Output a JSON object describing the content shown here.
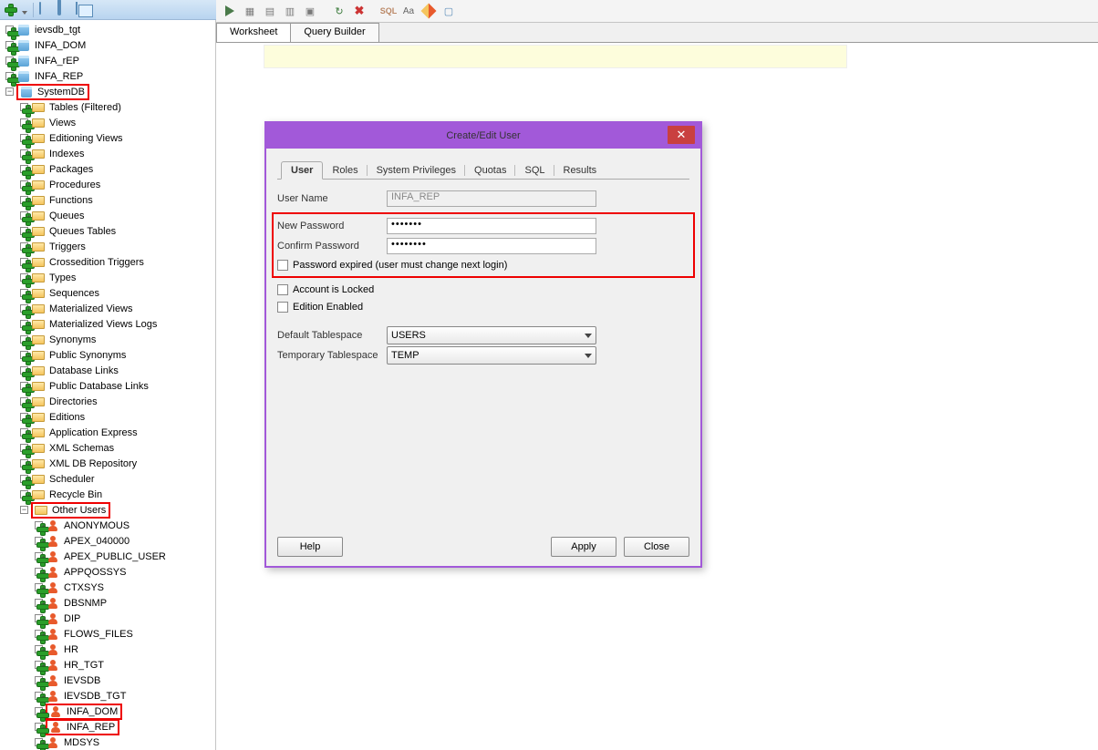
{
  "toolbar_left": {
    "items": [
      "add",
      "dropdown",
      "sep",
      "db",
      "filter",
      "copy"
    ]
  },
  "tree": {
    "connections": [
      "ievsdb_tgt",
      "INFA_DOM",
      "INFA_rEP",
      "INFA_REP"
    ],
    "selected_conn": "SystemDB",
    "schema_folders": [
      "Tables (Filtered)",
      "Views",
      "Editioning Views",
      "Indexes",
      "Packages",
      "Procedures",
      "Functions",
      "Queues",
      "Queues Tables",
      "Triggers",
      "Crossedition Triggers",
      "Types",
      "Sequences",
      "Materialized Views",
      "Materialized Views Logs",
      "Synonyms",
      "Public Synonyms",
      "Database Links",
      "Public Database Links",
      "Directories",
      "Editions",
      "Application Express",
      "XML Schemas",
      "XML DB Repository",
      "Scheduler",
      "Recycle Bin"
    ],
    "other_users_label": "Other Users",
    "other_users": [
      "ANONYMOUS",
      "APEX_040000",
      "APEX_PUBLIC_USER",
      "APPQOSSYS",
      "CTXSYS",
      "DBSNMP",
      "DIP",
      "FLOWS_FILES",
      "HR",
      "HR_TGT",
      "IEVSDB",
      "IEVSDB_TGT",
      "INFA_DOM",
      "INFA_REP",
      "MDSYS"
    ],
    "other_users_highlighted": [
      "INFA_DOM",
      "INFA_REP"
    ]
  },
  "worksheet_tabs": [
    "Worksheet",
    "Query Builder"
  ],
  "dialog": {
    "title": "Create/Edit User",
    "tabs": [
      "User",
      "Roles",
      "System Privileges",
      "Quotas",
      "SQL",
      "Results"
    ],
    "active_tab": "User",
    "user_name_label": "User Name",
    "user_name_value": "INFA_REP",
    "new_password_label": "New Password",
    "new_password_value": "•••••••",
    "confirm_password_label": "Confirm Password",
    "confirm_password_value": "••••••••",
    "chk_expired": "Password expired (user must change next login)",
    "chk_locked": "Account is Locked",
    "chk_edition": "Edition Enabled",
    "default_ts_label": "Default Tablespace",
    "default_ts_value": "USERS",
    "temp_ts_label": "Temporary Tablespace",
    "temp_ts_value": "TEMP",
    "btn_help": "Help",
    "btn_apply": "Apply",
    "btn_close": "Close"
  }
}
